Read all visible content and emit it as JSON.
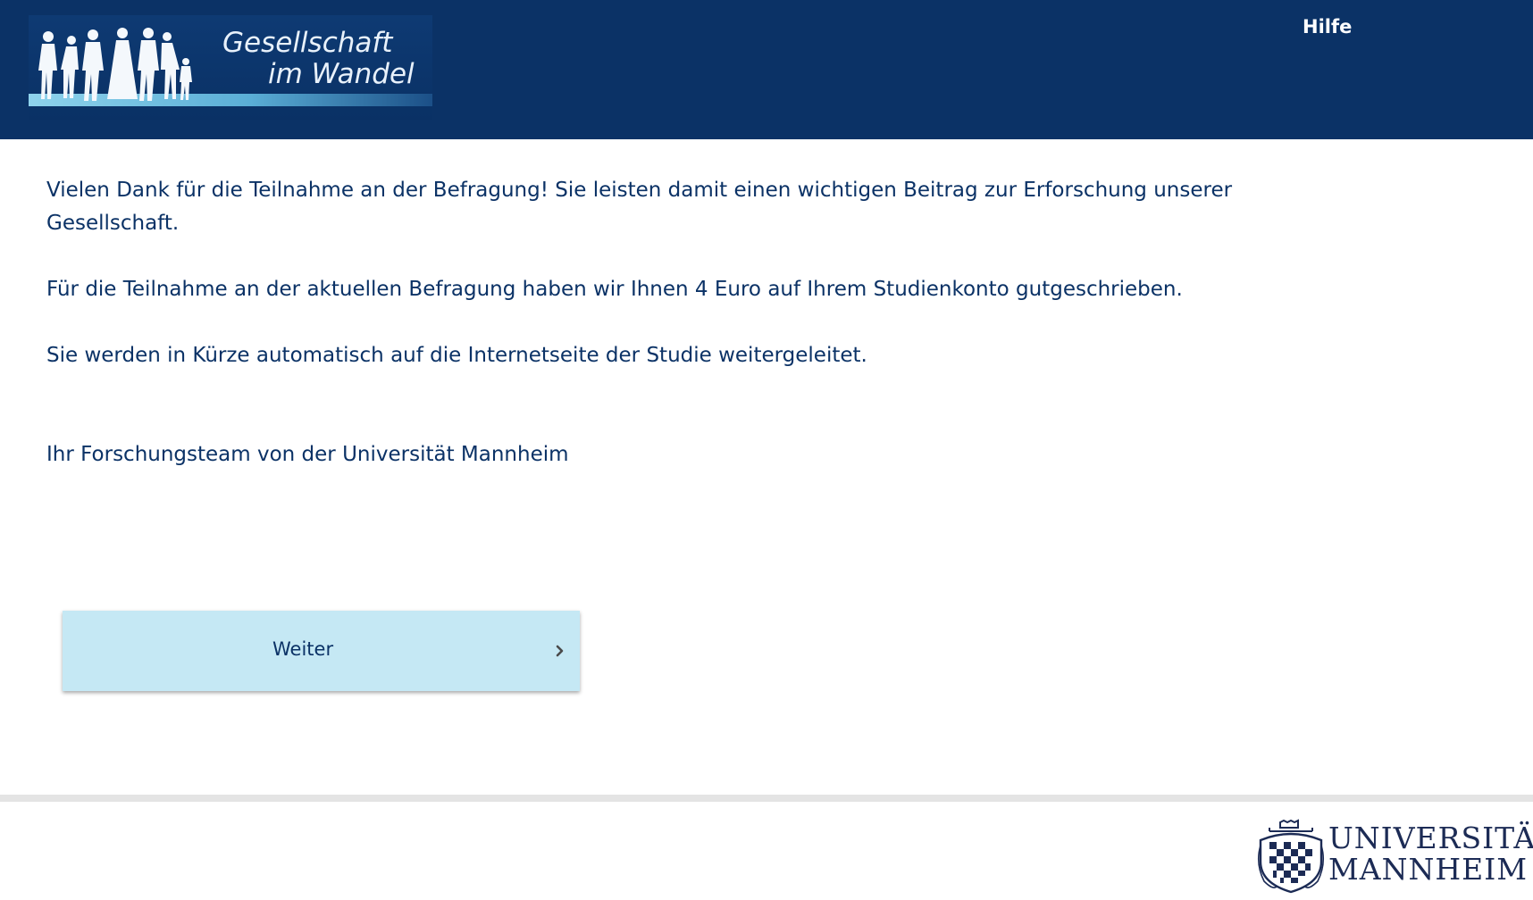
{
  "header": {
    "logo": {
      "line1": "Gesellschaft",
      "line2": "im Wandel"
    },
    "help_label": "Hilfe",
    "background": "#0b3266"
  },
  "main": {
    "paragraphs": {
      "thanks": "Vielen Dank für die Teilnahme an der Befragung! Sie leisten damit einen wichtigen Beitrag zur Erforschung unserer Gesellschaft.",
      "credit": "Für die Teilnahme an der aktuellen Befragung haben wir Ihnen 4 Euro auf Ihrem Studienkonto gutgeschrieben.",
      "redirect": "Sie werden in Kürze automatisch auf die Internetseite der Studie weitergeleitet.",
      "signature": "Ihr Forschungsteam von der Universität Mannheim"
    },
    "text_color": "#0b3266"
  },
  "next_button": {
    "label": "Weiter",
    "icon": "chevron-right-icon",
    "background": "#c5e8f4"
  },
  "footer": {
    "university_logo": {
      "line1": "UNIVERSITÄT",
      "line2": "MANNHEIM"
    }
  }
}
